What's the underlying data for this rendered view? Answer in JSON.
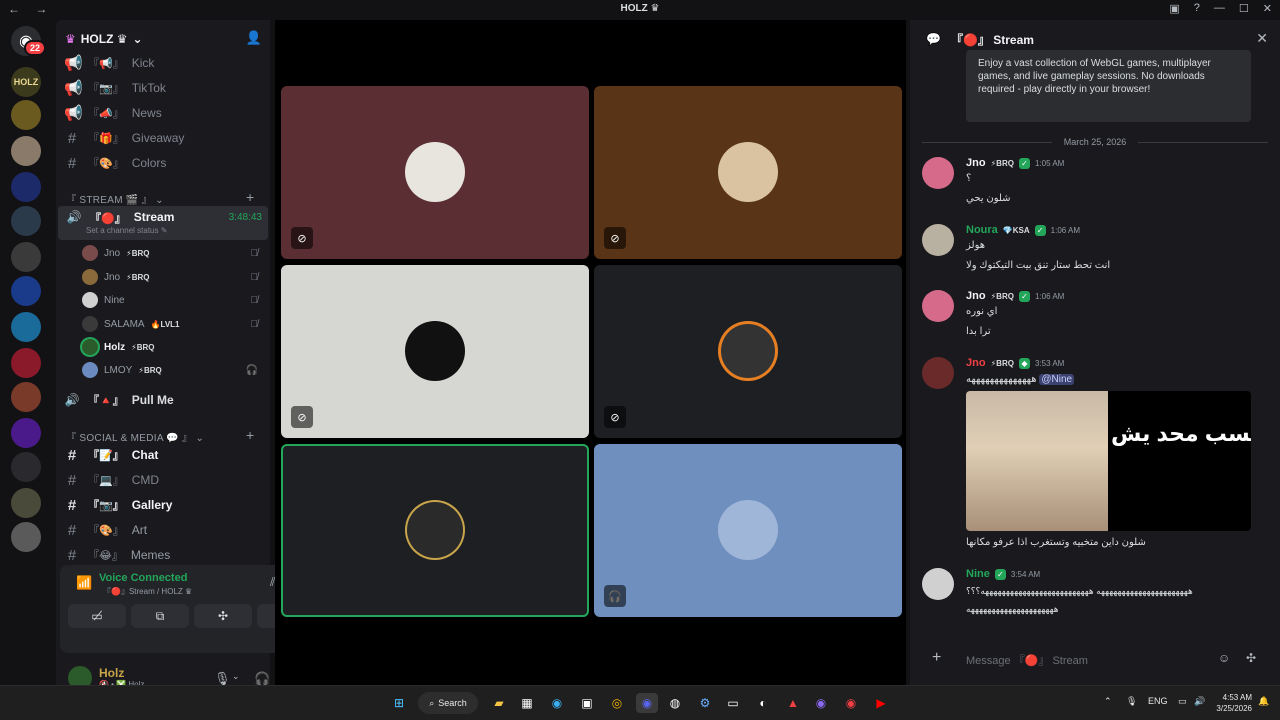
{
  "window": {
    "title": "HOLZ ♛",
    "nav": "← →",
    "controls": [
      "▣",
      "?",
      "—",
      "☐",
      "✕"
    ]
  },
  "rail": {
    "badge": "22"
  },
  "guild": {
    "name": "HOLZ ♛",
    "chevron": "⌄"
  },
  "channels": {
    "top": [
      {
        "icon": "📢",
        "emoji": "『📢』",
        "label": "Kick"
      },
      {
        "icon": "📢",
        "emoji": "『📷』",
        "label": "TikTok"
      },
      {
        "icon": "📢",
        "emoji": "『📣』",
        "label": "News"
      },
      {
        "icon": "#",
        "emoji": "『🎁』",
        "label": "Giveaway"
      },
      {
        "icon": "#",
        "emoji": "『🎨』",
        "label": "Colors"
      }
    ],
    "stream_category": "『 STREAM 🎬 』",
    "active": {
      "emoji": "『🔴』",
      "label": "Stream",
      "status": "Set a channel status ✎",
      "timer": "3:48:43"
    },
    "voice_users": [
      {
        "name": "Jno",
        "tag": "⚡BRQ",
        "avatar_color": "#7a4b4b"
      },
      {
        "name": "Jno",
        "tag": "⚡BRQ",
        "avatar_color": "#8a6a3a"
      },
      {
        "name": "Nine",
        "tag": "",
        "avatar_color": "#d0d0d0"
      },
      {
        "name": "SALAMA",
        "tag": "🔥LVL1",
        "avatar_color": "#3a3a3a"
      },
      {
        "name": "Holz",
        "tag": "⚡BRQ",
        "avatar_color": "#2b5b2b"
      },
      {
        "name": "LMOY",
        "tag": "⚡BRQ",
        "avatar_color": "#6a8ac0"
      }
    ],
    "pull_me": {
      "emoji": "『🔺』",
      "label": "Pull Me"
    },
    "social_category": "『 SOCIAL & MEDIA 💬 』",
    "social": [
      {
        "emoji": "『📝』",
        "label": "Chat",
        "bright": true
      },
      {
        "emoji": "『💻』",
        "label": "CMD",
        "bright": false
      },
      {
        "emoji": "『📷』",
        "label": "Gallery",
        "bright": true
      },
      {
        "emoji": "『🎨』",
        "label": "Art",
        "bright": false
      },
      {
        "emoji": "『😂』",
        "label": "Memes",
        "bright": false
      }
    ]
  },
  "voice": {
    "connected": "Voice Connected",
    "location": "『🔴』Stream / HOLZ ♛"
  },
  "user": {
    "name": "Holz",
    "status": "🔇 • ❎ Holz"
  },
  "tiles": [
    {
      "bg": "#5a2e33",
      "muted": true
    },
    {
      "bg": "#5a3416",
      "muted": true
    },
    {
      "bg": "#d6d6d3",
      "muted": true
    },
    {
      "bg": "#1e1f22",
      "muted": true
    },
    {
      "bg": "#1e1f22",
      "muted": false,
      "speaking": true
    },
    {
      "bg": "#6f8fbf",
      "muted": true
    }
  ],
  "chat": {
    "title": "『🔴』 Stream",
    "embed": "Enjoy a vast collection of WebGL games, multiplayer games, and live gameplay sessions. No downloads required - play directly in your browser!",
    "date": "March 25, 2026",
    "messages": [
      {
        "name": "Jno",
        "color": "#f2f3f5",
        "tag": "⚡BRQ",
        "time": "1:05 AM",
        "lines": [
          "؟",
          "شلون يحي"
        ]
      },
      {
        "name": "Noura",
        "color": "#23a55a",
        "tag": "💎KSA",
        "time": "1:06 AM",
        "lines": [
          "هولز",
          "انت تحط ستار تنق بيت التيكتوك ولا"
        ]
      },
      {
        "name": "Jno",
        "color": "#f2f3f5",
        "tag": "⚡BRQ",
        "time": "1:06 AM",
        "lines": [
          "اي نوره",
          "ترا بدا"
        ]
      },
      {
        "name": "Jno",
        "color": "#f23f43",
        "tag": "⚡BRQ",
        "time": "3:53 AM",
        "lines": [
          "ههههههههههههههه",
          "@Nine"
        ]
      },
      {
        "name": "Nine",
        "color": "#23a55a",
        "tag": "",
        "time": "3:54 AM",
        "lines": [
          "ههههههههههههههههههههههه ههههههههههههههههههههههههههه؟؟؟",
          "هههههههههههههههههههههه"
        ]
      }
    ],
    "media_caption": "احسب محد يش",
    "media_text": "شلون داين متخبيه وتستغرب اذا عرفو مكانها",
    "composer": "Message 『🔴』 Stream"
  },
  "taskbar": {
    "search": "Search",
    "lang": "ENG",
    "time": "4:53 AM",
    "date": "3/25/2026"
  }
}
